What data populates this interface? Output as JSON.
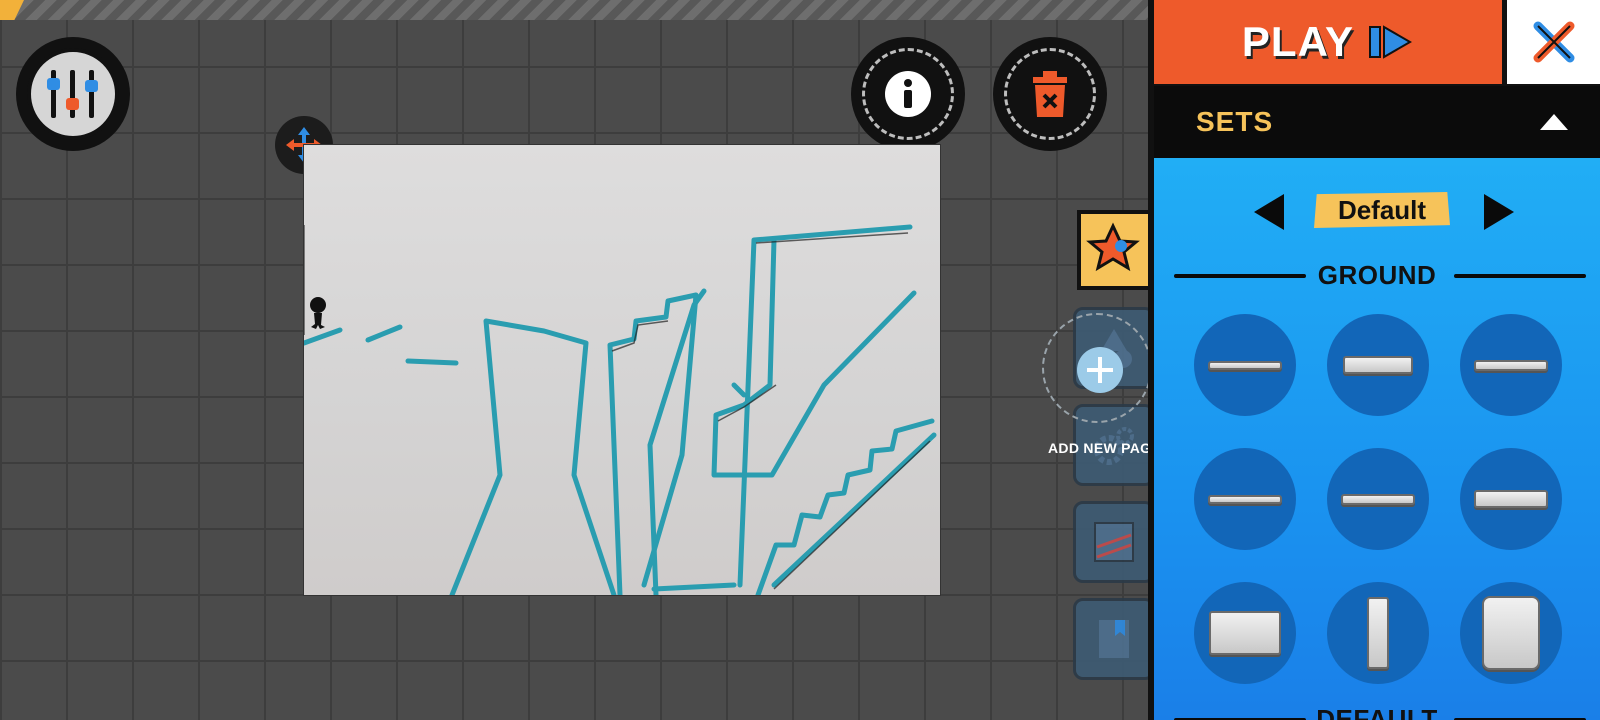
{
  "editor": {
    "settings_icon": "sliders-icon",
    "info_icon": "info-icon",
    "trash_icon": "trash-icon",
    "move_icon": "move-arrows-icon",
    "add_page_label": "ADD NEW PAGE"
  },
  "panel": {
    "play_label": "PLAY",
    "sets_title": "SETS",
    "current_set": "Default",
    "sections": [
      {
        "title": "GROUND"
      },
      {
        "title": "DEFAULT"
      }
    ],
    "ground_pieces": [
      "thin-platform",
      "stone-slab",
      "thin-platform",
      "thin-platform",
      "thin-platform",
      "stone-slab",
      "stone-block",
      "stone-pillar",
      "stone-block-large"
    ]
  },
  "colors": {
    "play": "#ee5a2b",
    "accent": "#f6c35a",
    "panel_blue": "#21aef5",
    "piece_bg": "#1266b8"
  }
}
